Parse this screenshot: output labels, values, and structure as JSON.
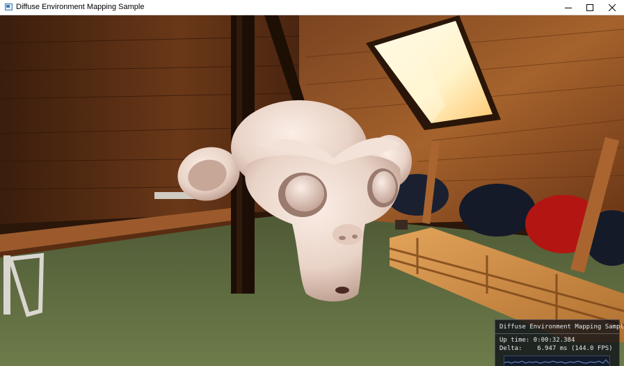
{
  "window": {
    "title": "Diffuse Environment Mapping Sample",
    "controls": {
      "minimize": "minimize-icon",
      "maximize": "maximize-icon",
      "close": "close-icon"
    }
  },
  "stats_overlay": {
    "title": "Diffuse Environment Mapping Sample",
    "uptime_label": "Up time:",
    "uptime_value": "0:00:32.384",
    "delta_label": "Delta:",
    "delta_value": "6.947 ms (144.0 FPS)"
  }
}
